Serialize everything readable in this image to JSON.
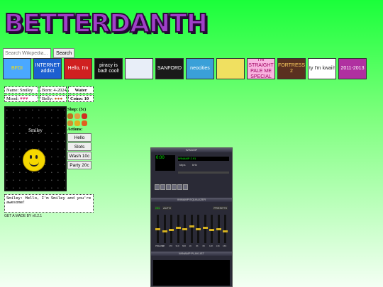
{
  "logo": "BETTERDANTH",
  "search": {
    "placeholder": "Search Wikipedia...",
    "button": "Search"
  },
  "badges": [
    {
      "text": "BFDI",
      "bg": "#4aa8ff",
      "fg": "#ffe000"
    },
    {
      "text": "INTERNET addict",
      "bg": "#1c5fd0",
      "fg": "#ffffff"
    },
    {
      "text": "Hello, I'm",
      "bg": "#d02020",
      "fg": "#ffffff"
    },
    {
      "text": "piracy is bad! cool!",
      "bg": "#111111",
      "fg": "#ffffff"
    },
    {
      "text": "",
      "bg": "#e8eef8",
      "fg": "#0030a0"
    },
    {
      "text": "SANFORD",
      "bg": "#1a1a1a",
      "fg": "#ffffff"
    },
    {
      "text": "neocities",
      "bg": "#3aa0d8",
      "fg": "#ffffff"
    },
    {
      "text": "",
      "bg": "#f0e060",
      "fg": "#000"
    },
    {
      "text": "I'M STRAIGHT PALE ME SPECIAL",
      "bg": "#f9b4e0",
      "fg": "#a00060"
    },
    {
      "text": "FORTRESS 2",
      "bg": "#5a3020",
      "fg": "#ffd060"
    },
    {
      "text": "ty I'm kwaii!",
      "bg": "#ffffff",
      "fg": "#222"
    },
    {
      "text": "2011-2013",
      "bg": "#b030a0",
      "fg": "#ffffff"
    }
  ],
  "pet": {
    "name_label": "Name: Smiley",
    "born_label": "Born: 4-2024",
    "water_label": "Water",
    "mood_label": "Mood:",
    "belly_label": "Belly:",
    "coins_label": "Coins: 10",
    "stage_name": "Smiley",
    "shop_label": "Shop: (5c)",
    "actions_label": "Actions:",
    "actions": [
      "Hello",
      "Slots",
      "Wash 10c",
      "Party 20c"
    ],
    "speech": "Smiley: Hello, I'm Smiley and you're awesome!",
    "footer": "GET A          MADE BY         v0.2.1"
  },
  "winamp": {
    "title": "WINAMP",
    "display": "0:00",
    "song": "WINAMP 2.91",
    "kbps": "kbps",
    "khz": "kHz",
    "eq_title": "WINAMP EQUALIZER",
    "eq_on": "ON",
    "eq_auto": "AUTO",
    "eq_presets": "PRESETS",
    "eq_bands": [
      0.5,
      0.4,
      0.45,
      0.55,
      0.5,
      0.6,
      0.5,
      0.55,
      0.45,
      0.5,
      0.4
    ],
    "eq_labels": [
      "PREAMP",
      "60",
      "170",
      "310",
      "600",
      "1K",
      "3K",
      "6K",
      "12K",
      "14K",
      "16K"
    ],
    "pl_title": "WINAMP PLAYLIST"
  }
}
